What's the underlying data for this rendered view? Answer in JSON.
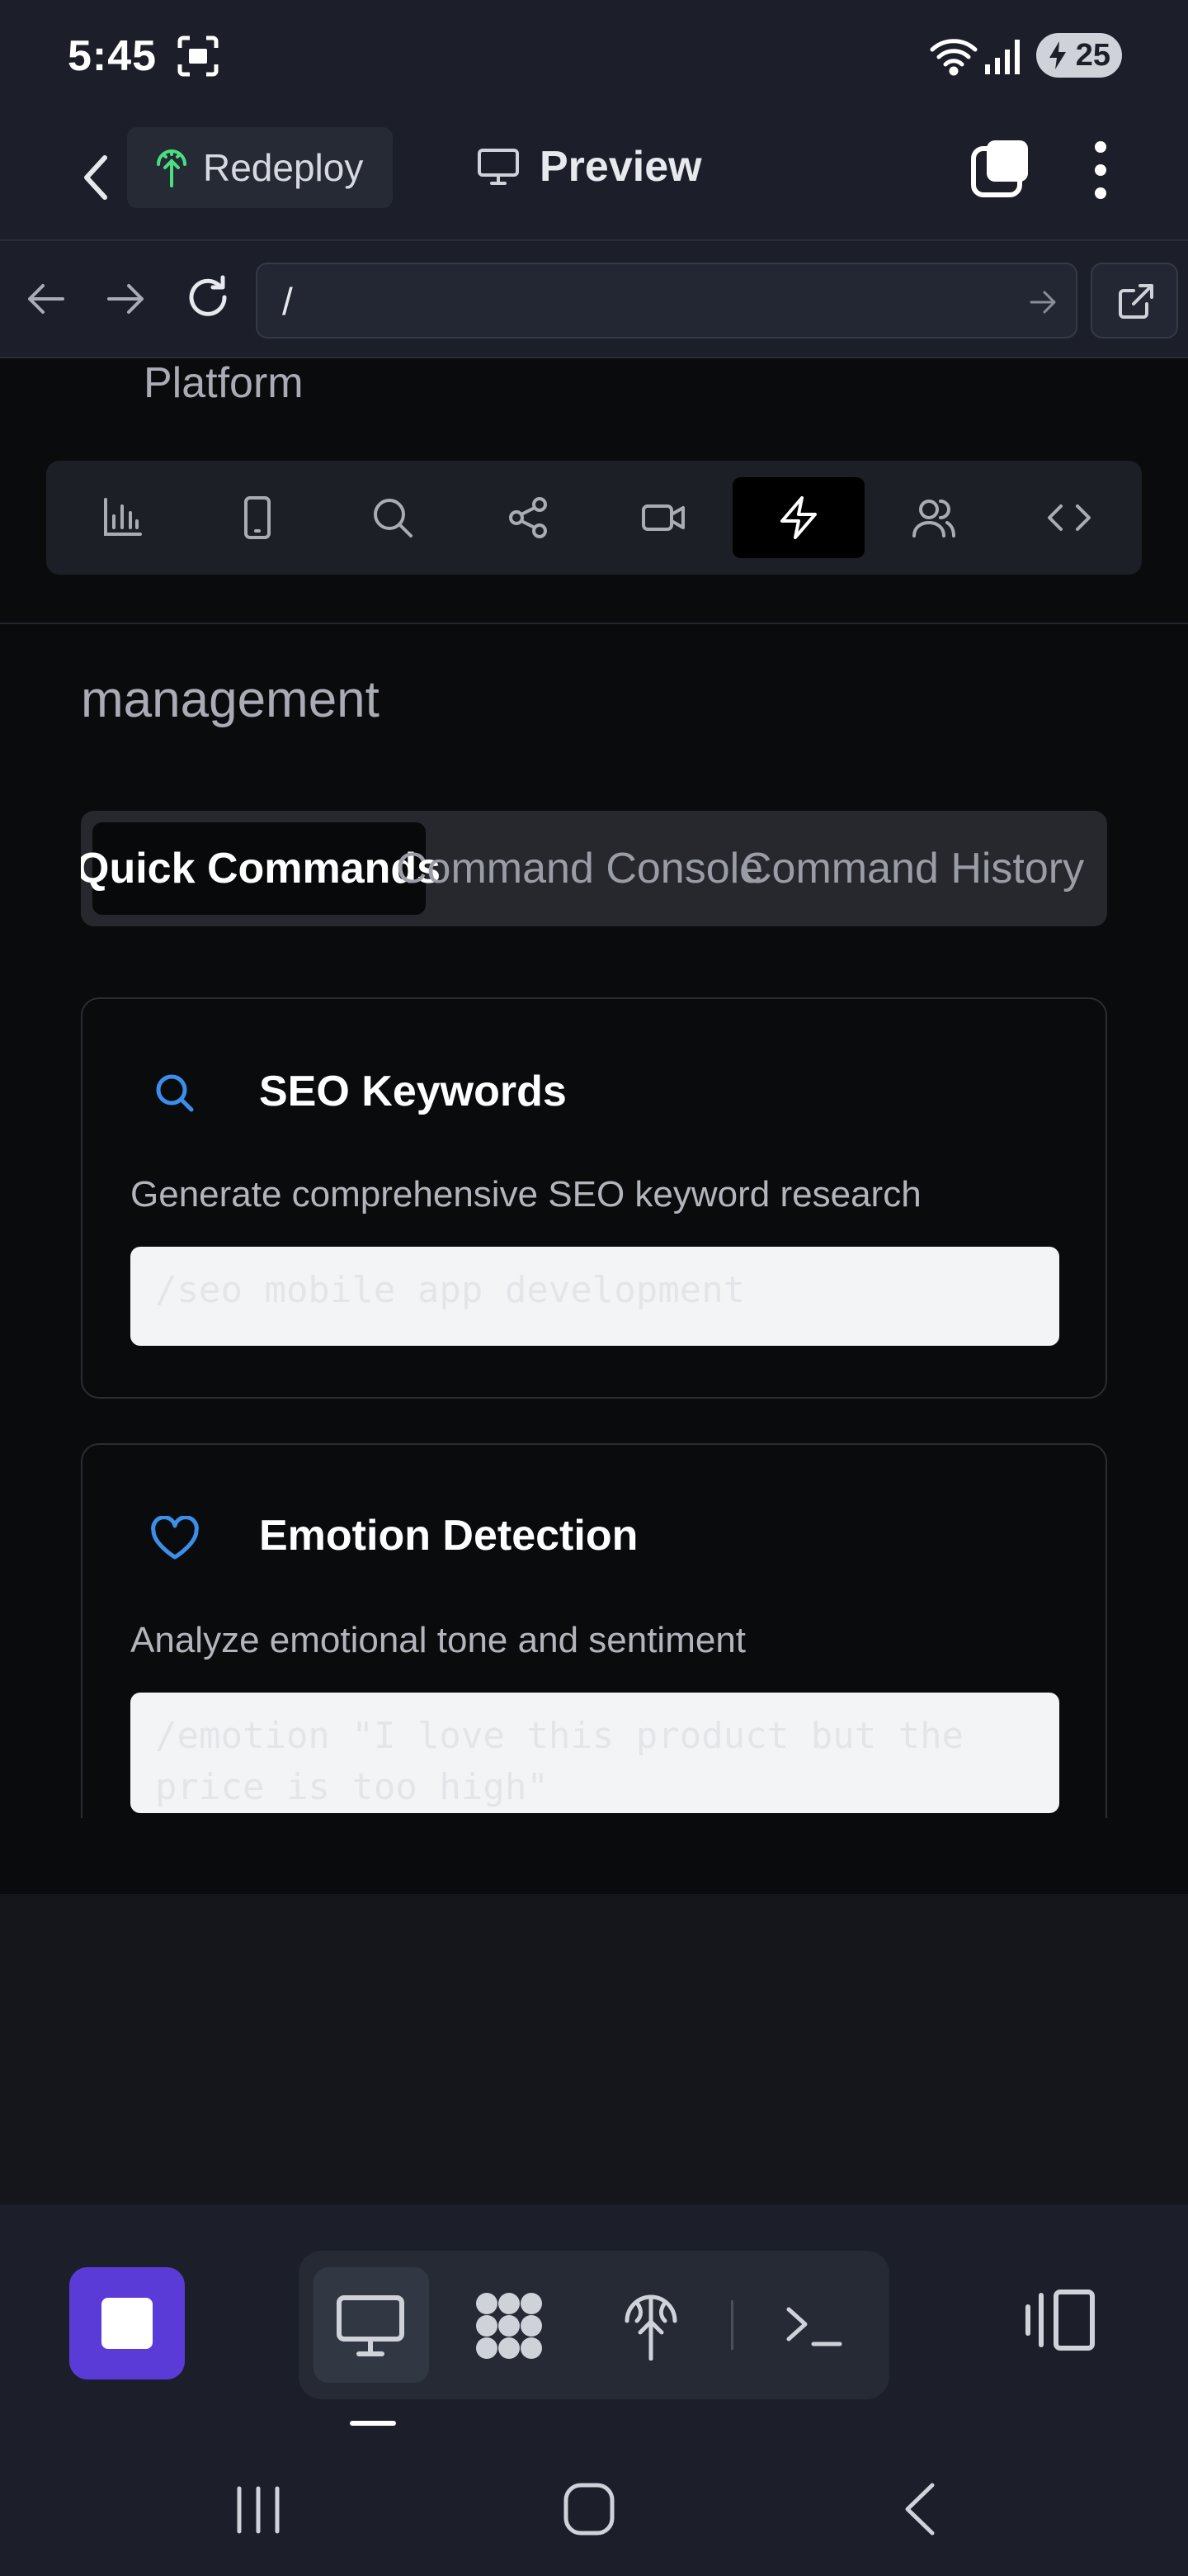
{
  "status_bar": {
    "time": "5:45",
    "battery": "25"
  },
  "app_bar": {
    "redeploy_label": "Redeploy",
    "preview_label": "Preview"
  },
  "url_bar": {
    "path": "/"
  },
  "page": {
    "platform_text": "Platform",
    "management_text": "management",
    "toolbar_icons": [
      "bar-chart-icon",
      "mobile-icon",
      "search-icon",
      "share-icon",
      "video-icon",
      "lightning-icon",
      "users-icon",
      "code-icon"
    ],
    "active_toolbar_icon": "lightning-icon",
    "tabs": [
      {
        "label": "Quick Commands",
        "active": true
      },
      {
        "label": "Command Console",
        "active": false
      },
      {
        "label": "Command History",
        "active": false
      }
    ],
    "cards": [
      {
        "title": "SEO Keywords",
        "icon": "search-icon",
        "description": "Generate comprehensive SEO keyword research",
        "command_placeholder": "/seo mobile app development"
      },
      {
        "title": "Emotion Detection",
        "icon": "heart-icon",
        "description": "Analyze emotional tone and sentiment",
        "command_placeholder": "/emotion \"I love this product but the price is too high\""
      }
    ]
  },
  "bottom_bar": {
    "items": [
      "stop-button",
      "desktop-icon",
      "apps-icon",
      "deploy-icon",
      "terminal-icon",
      "panel-toggle-icon"
    ]
  },
  "colors": {
    "accent": "#5b3bd8",
    "card_icon": "#3b8eea",
    "redeploy_icon": "#4ade80"
  }
}
